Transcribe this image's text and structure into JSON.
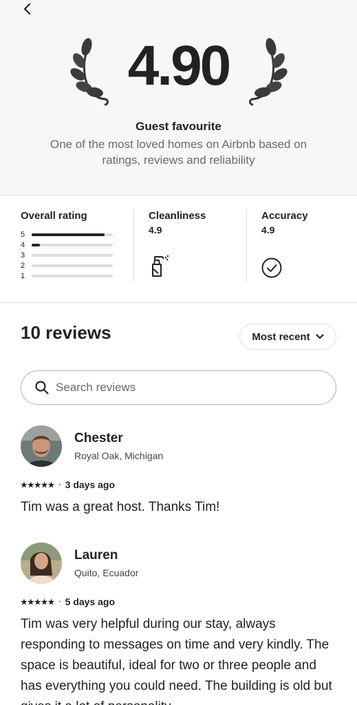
{
  "hero": {
    "score": "4.90",
    "guest_favourite": "Guest favourite",
    "description": "One of the most loved homes on Airbnb based on ratings, reviews and reliability"
  },
  "ratings": {
    "overall_label": "Overall rating",
    "distribution": [
      {
        "stars": "5",
        "fraction": 0.9
      },
      {
        "stars": "4",
        "fraction": 0.1
      },
      {
        "stars": "3",
        "fraction": 0
      },
      {
        "stars": "2",
        "fraction": 0
      },
      {
        "stars": "1",
        "fraction": 0
      }
    ],
    "cleanliness_label": "Cleanliness",
    "cleanliness_value": "4.9",
    "accuracy_label": "Accuracy",
    "accuracy_value": "4.9"
  },
  "reviews": {
    "title": "10 reviews",
    "sort_label": "Most recent",
    "search_placeholder": "Search reviews",
    "items": [
      {
        "name": "Chester",
        "location": "Royal Oak, Michigan",
        "stars": "★★★★★",
        "date": "3 days ago",
        "text": "Tim was a great host. Thanks Tim!",
        "avatar_color": "#8a6a54"
      },
      {
        "name": "Lauren",
        "location": "Quito, Ecuador",
        "stars": "★★★★★",
        "date": "5 days ago",
        "text": "Tim was very helpful during our stay, always responding to messages on time and very kindly. The space is beautiful, ideal for two or three people and has everything you could need. The building is old but gives it a lot of personality.",
        "avatar_color": "#c8b49a"
      }
    ]
  },
  "icons": {
    "back": "chevron-left-icon",
    "laurel": "laurel-icon",
    "cleanliness": "spray-bottle-icon",
    "accuracy": "check-circle-icon",
    "search": "search-icon",
    "sort": "chevron-down-icon"
  }
}
